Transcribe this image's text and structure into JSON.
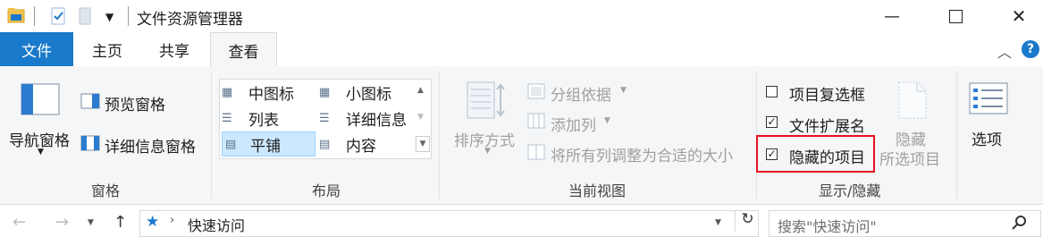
{
  "window": {
    "title": "文件资源管理器"
  },
  "tabs": {
    "file": "文件",
    "home": "主页",
    "share": "共享",
    "view": "查看"
  },
  "ribbon": {
    "panes": {
      "nav_pane": "导航窗格",
      "preview_pane": "预览窗格",
      "details_pane": "详细信息窗格",
      "group_label": "窗格"
    },
    "layout": {
      "items": [
        "中图标",
        "小图标",
        "列表",
        "详细信息",
        "平铺",
        "内容"
      ],
      "selected": "平铺",
      "group_label": "布局"
    },
    "current_view": {
      "sort_by": "排序方式",
      "group_by": "分组依据",
      "add_column": "添加列",
      "fit_columns": "将所有列调整为合适的大小",
      "group_label": "当前视图"
    },
    "show_hide": {
      "item_checkboxes": {
        "label": "项目复选框",
        "checked": false
      },
      "file_extensions": {
        "label": "文件扩展名",
        "checked": true
      },
      "hidden_items": {
        "label": "隐藏的项目",
        "checked": true
      },
      "hide_selected_line1": "隐藏",
      "hide_selected_line2": "所选项目",
      "group_label": "显示/隐藏"
    },
    "options": "选项"
  },
  "address": {
    "path": "快速访问",
    "search_placeholder": "搜索\"快速访问\""
  },
  "colors": {
    "accent": "#1979ca",
    "highlight": "#e81123",
    "selected_bg": "#cce8ff"
  }
}
